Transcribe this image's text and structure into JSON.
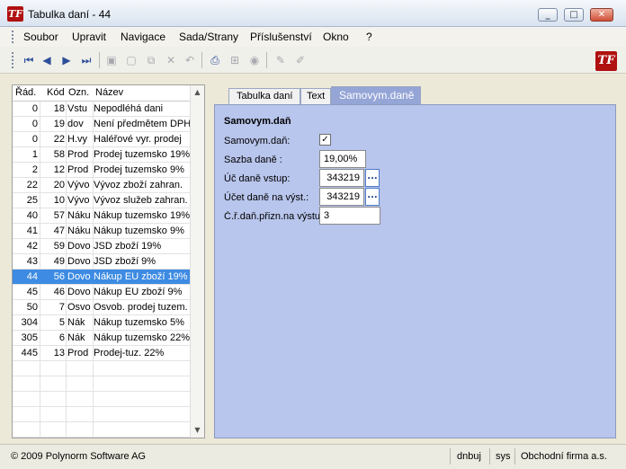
{
  "window": {
    "title": "Tabulka daní - 44",
    "app_icon": "TF"
  },
  "menu": [
    "Soubor",
    "Upravit",
    "Navigace",
    "Sada/Strany",
    "Příslušenství",
    "Okno",
    "?"
  ],
  "toolbar": {
    "buttons": [
      {
        "name": "first-record-icon",
        "glyph": "⏮",
        "enabled": true
      },
      {
        "name": "prev-record-icon",
        "glyph": "◀",
        "enabled": true
      },
      {
        "name": "next-record-icon",
        "glyph": "▶",
        "enabled": true
      },
      {
        "name": "last-record-icon",
        "glyph": "⏭",
        "enabled": true
      },
      {
        "name": "save-icon",
        "glyph": "▣",
        "enabled": false
      },
      {
        "name": "new-icon",
        "glyph": "▢",
        "enabled": false
      },
      {
        "name": "copy-icon",
        "glyph": "⧉",
        "enabled": false
      },
      {
        "name": "delete-icon",
        "glyph": "✕",
        "enabled": false
      },
      {
        "name": "undo-icon",
        "glyph": "↶",
        "enabled": false
      },
      {
        "name": "print-icon",
        "glyph": "⎙",
        "enabled": true
      },
      {
        "name": "tree-icon",
        "glyph": "⊞",
        "enabled": false
      },
      {
        "name": "filter-icon",
        "glyph": "◉",
        "enabled": false
      },
      {
        "name": "edit-icon",
        "glyph": "✎",
        "enabled": false
      },
      {
        "name": "pencil-icon",
        "glyph": "✐",
        "enabled": false
      }
    ],
    "logo": "TF"
  },
  "grid": {
    "columns": [
      "Řád.",
      "Kód",
      "Ozn.",
      "Název"
    ],
    "rows": [
      {
        "rad": "0",
        "kod": "18",
        "ozn": "Vstu",
        "nazev": "Nepodléhá dani",
        "selected": false
      },
      {
        "rad": "0",
        "kod": "19",
        "ozn": "dov",
        "nazev": "Není předmětem DPH",
        "selected": false
      },
      {
        "rad": "0",
        "kod": "22",
        "ozn": "H.vy",
        "nazev": "Haléřové vyr. prodej",
        "selected": false
      },
      {
        "rad": "1",
        "kod": "58",
        "ozn": "Prod",
        "nazev": "Prodej tuzemsko 19%",
        "selected": false
      },
      {
        "rad": "2",
        "kod": "12",
        "ozn": "Prod",
        "nazev": "Prodej tuzemsko 9%",
        "selected": false
      },
      {
        "rad": "22",
        "kod": "20",
        "ozn": "Vývo",
        "nazev": "Vývoz zboží zahran.",
        "selected": false
      },
      {
        "rad": "25",
        "kod": "10",
        "ozn": "Vývo",
        "nazev": "Vývoz služeb zahran.",
        "selected": false
      },
      {
        "rad": "40",
        "kod": "57",
        "ozn": "Náku",
        "nazev": "Nákup tuzemsko 19%",
        "selected": false
      },
      {
        "rad": "41",
        "kod": "47",
        "ozn": "Náku",
        "nazev": "Nákup tuzemsko 9%",
        "selected": false
      },
      {
        "rad": "42",
        "kod": "59",
        "ozn": "Dovo",
        "nazev": "JSD zboží 19%",
        "selected": false
      },
      {
        "rad": "43",
        "kod": "49",
        "ozn": "Dovo",
        "nazev": "JSD zboží 9%",
        "selected": false
      },
      {
        "rad": "44",
        "kod": "56",
        "ozn": "Dovo",
        "nazev": "Nákup EU zboží 19%",
        "selected": true
      },
      {
        "rad": "45",
        "kod": "46",
        "ozn": "Dovo",
        "nazev": "Nákup EU zboží 9%",
        "selected": false
      },
      {
        "rad": "50",
        "kod": "7",
        "ozn": "Osvo",
        "nazev": "Osvob. prodej tuzem.",
        "selected": false
      },
      {
        "rad": "304",
        "kod": "5",
        "ozn": "Nák",
        "nazev": "Nákup tuzemsko 5%",
        "selected": false
      },
      {
        "rad": "305",
        "kod": "6",
        "ozn": "Nák",
        "nazev": "Nákup tuzemsko 22%",
        "selected": false
      },
      {
        "rad": "445",
        "kod": "13",
        "ozn": "Prod",
        "nazev": "Prodej-tuz. 22%",
        "selected": false
      }
    ]
  },
  "tabs": [
    {
      "label": "Tabulka daní",
      "active": false
    },
    {
      "label": "Text",
      "active": false
    },
    {
      "label": "Samovym.daně",
      "active": true
    }
  ],
  "form": {
    "section_title": "Samovym.daň",
    "samovym_label": "Samovym.daň:",
    "samovym_checked": true,
    "sazba_label": "Sazba daně  :",
    "sazba_value": "19,00%",
    "uc_vstup_label": "Úč daně vstup:",
    "uc_vstup_value": "343219",
    "ucet_vyst_label": "Účet daně na výst.:",
    "ucet_vyst_value": "343219",
    "cr_label": "Č.ř.daň.přizn.na výstu",
    "cr_value": "3",
    "browse_label": "..."
  },
  "status": {
    "copyright": "© 2009 Polynorm Software AG",
    "user": "dnbuj",
    "db": "sys",
    "company": "Obchodní firma a.s."
  }
}
